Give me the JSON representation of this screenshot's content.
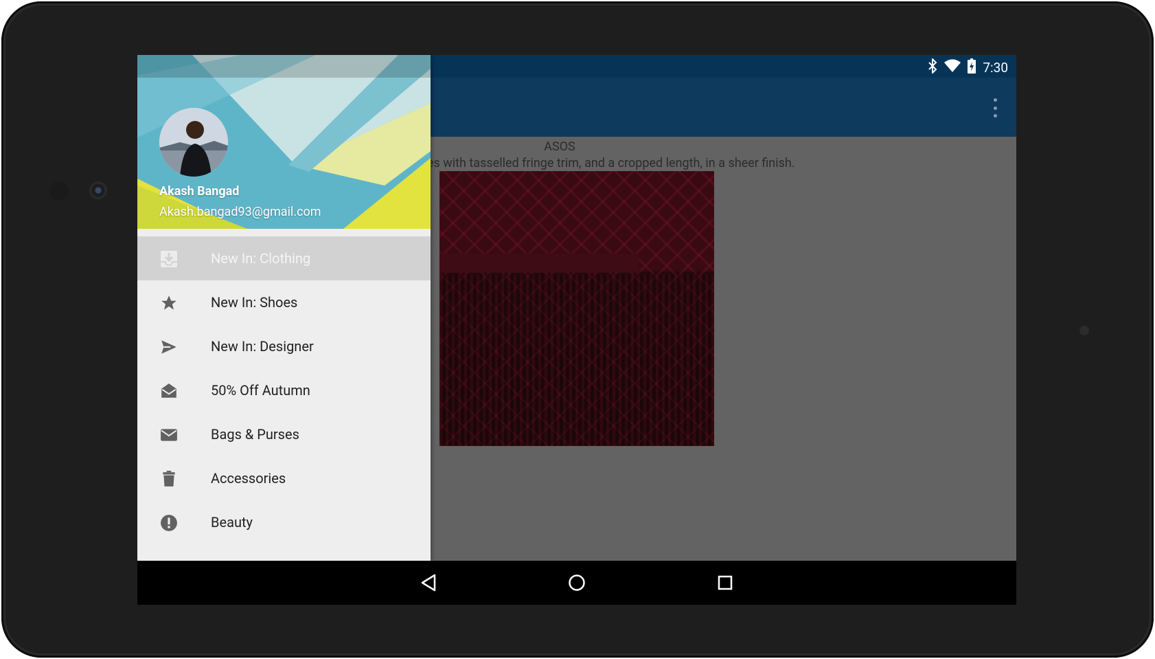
{
  "status_bar": {
    "time": "7:30",
    "left_icons": [
      "android-debug-icon",
      "clipboard-check-icon"
    ],
    "right_icons": [
      "bluetooth-icon",
      "wifi-icon",
      "battery-icon"
    ]
  },
  "app_bar": {
    "overflow_icon": "overflow-menu-icon"
  },
  "content": {
    "brand": "ASOS",
    "description": "e, raglan style slashed sleeves with tasselled fringe trim, and a cropped length, in a sheer finish."
  },
  "drawer": {
    "user": {
      "name": "Akash Bangad",
      "email": "Akash.bangad93@gmail.com"
    },
    "items": [
      {
        "label": "New In: Clothing",
        "icon": "inbox-download-icon",
        "active": true
      },
      {
        "label": "New In: Shoes",
        "icon": "star-icon",
        "active": false
      },
      {
        "label": "New In: Designer",
        "icon": "send-icon",
        "active": false
      },
      {
        "label": "50% Off Autumn",
        "icon": "drafts-icon",
        "active": false
      },
      {
        "label": "Bags & Purses",
        "icon": "mail-icon",
        "active": false
      },
      {
        "label": "Accessories",
        "icon": "trash-icon",
        "active": false
      },
      {
        "label": "Beauty",
        "icon": "alert-icon",
        "active": false
      }
    ]
  },
  "nav_bar": {
    "buttons": [
      "back-icon",
      "home-icon",
      "recents-icon"
    ]
  },
  "colors": {
    "status_bar": "#063457",
    "app_bar": "#0e3a5e",
    "drawer_bg": "#eeeeee",
    "active_item": "#d2d2d2",
    "scrim": "#636363"
  }
}
